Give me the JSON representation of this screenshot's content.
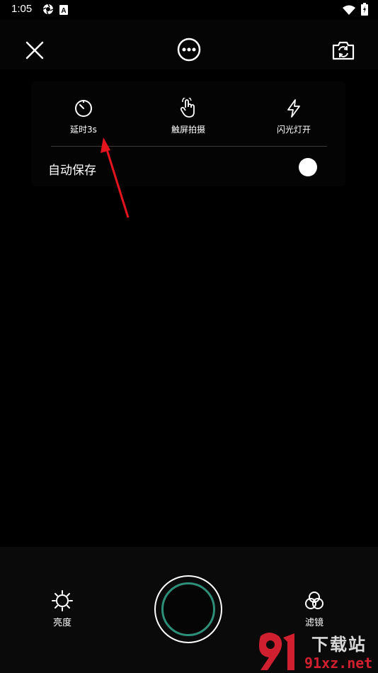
{
  "status_bar": {
    "time": "1:05",
    "icons": [
      "camera-shutter-icon",
      "app-a-icon",
      "wifi-icon",
      "battery-charging-icon"
    ]
  },
  "top_bar": {
    "icons": [
      "close-icon",
      "more-options-icon",
      "switch-camera-icon"
    ]
  },
  "settings_panel": {
    "options": [
      {
        "label": "延时3s",
        "icon": "timer-icon"
      },
      {
        "label": "触屏拍摄",
        "icon": "touch-icon"
      },
      {
        "label": "闪光灯开",
        "icon": "flash-icon"
      }
    ],
    "auto_save_label": "自动保存",
    "auto_save_on": false
  },
  "annotation": {
    "color": "#e3141e"
  },
  "bottom": {
    "brightness_label": "亮度",
    "filter_label": "滤镜",
    "shutter_accent": "#2e8f78"
  },
  "watermark": {
    "top_text": "下载站",
    "bottom_text": "91xz.net",
    "color": "#d02030"
  }
}
